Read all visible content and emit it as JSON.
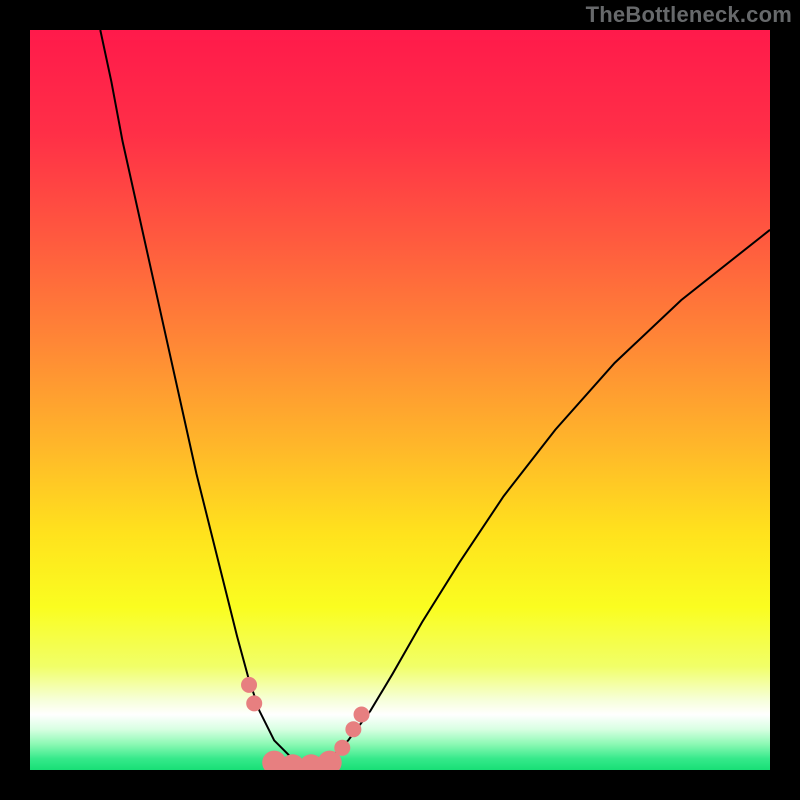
{
  "watermark": "TheBottleneck.com",
  "chart_data": {
    "type": "line",
    "title": "",
    "xlabel": "",
    "ylabel": "",
    "xlim": [
      0,
      100
    ],
    "ylim": [
      0,
      100
    ],
    "background_gradient": {
      "stops": [
        {
          "offset": 0.0,
          "color": "#ff1a4b"
        },
        {
          "offset": 0.14,
          "color": "#ff2f47"
        },
        {
          "offset": 0.28,
          "color": "#ff593f"
        },
        {
          "offset": 0.42,
          "color": "#ff8636"
        },
        {
          "offset": 0.56,
          "color": "#ffb62a"
        },
        {
          "offset": 0.68,
          "color": "#ffe21d"
        },
        {
          "offset": 0.78,
          "color": "#fafd20"
        },
        {
          "offset": 0.86,
          "color": "#f1ff68"
        },
        {
          "offset": 0.905,
          "color": "#f6ffd9"
        },
        {
          "offset": 0.925,
          "color": "#ffffff"
        },
        {
          "offset": 0.945,
          "color": "#d8ffe2"
        },
        {
          "offset": 0.965,
          "color": "#8cf9b4"
        },
        {
          "offset": 0.985,
          "color": "#35e98a"
        },
        {
          "offset": 1.0,
          "color": "#18df76"
        }
      ]
    },
    "series": [
      {
        "name": "bottleneck-curve",
        "color": "#000000",
        "width": 2.0,
        "points": [
          {
            "x": 9.5,
            "y": 100.0
          },
          {
            "x": 11.0,
            "y": 93.0
          },
          {
            "x": 12.5,
            "y": 85.0
          },
          {
            "x": 14.5,
            "y": 76.0
          },
          {
            "x": 16.5,
            "y": 67.0
          },
          {
            "x": 18.5,
            "y": 58.0
          },
          {
            "x": 20.5,
            "y": 49.0
          },
          {
            "x": 22.5,
            "y": 40.0
          },
          {
            "x": 24.5,
            "y": 32.0
          },
          {
            "x": 26.5,
            "y": 24.0
          },
          {
            "x": 28.0,
            "y": 18.0
          },
          {
            "x": 29.5,
            "y": 12.5
          },
          {
            "x": 31.0,
            "y": 8.0
          },
          {
            "x": 33.0,
            "y": 4.0
          },
          {
            "x": 35.5,
            "y": 1.5
          },
          {
            "x": 38.0,
            "y": 0.5
          },
          {
            "x": 40.5,
            "y": 1.5
          },
          {
            "x": 43.0,
            "y": 4.0
          },
          {
            "x": 46.0,
            "y": 8.0
          },
          {
            "x": 49.0,
            "y": 13.0
          },
          {
            "x": 53.0,
            "y": 20.0
          },
          {
            "x": 58.0,
            "y": 28.0
          },
          {
            "x": 64.0,
            "y": 37.0
          },
          {
            "x": 71.0,
            "y": 46.0
          },
          {
            "x": 79.0,
            "y": 55.0
          },
          {
            "x": 88.0,
            "y": 63.5
          },
          {
            "x": 100.0,
            "y": 73.0
          }
        ]
      }
    ],
    "markers": {
      "name": "highlighted-points",
      "color": "#e77f80",
      "radius_small": 8,
      "radius_large": 12,
      "points": [
        {
          "x": 29.6,
          "y": 11.5,
          "r": 8
        },
        {
          "x": 30.3,
          "y": 9.0,
          "r": 8
        },
        {
          "x": 33.0,
          "y": 1.0,
          "r": 12
        },
        {
          "x": 35.5,
          "y": 0.5,
          "r": 12
        },
        {
          "x": 38.0,
          "y": 0.5,
          "r": 12
        },
        {
          "x": 40.5,
          "y": 1.0,
          "r": 12
        },
        {
          "x": 42.2,
          "y": 3.0,
          "r": 8
        },
        {
          "x": 43.7,
          "y": 5.5,
          "r": 8
        },
        {
          "x": 44.8,
          "y": 7.5,
          "r": 8
        }
      ]
    }
  }
}
